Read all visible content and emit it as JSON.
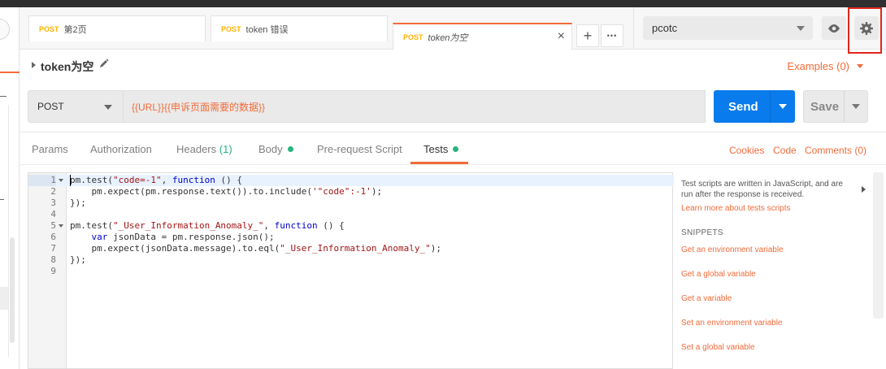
{
  "tabs": [
    {
      "method": "POST",
      "name": "第2页"
    },
    {
      "method": "POST",
      "name": "token 错误"
    },
    {
      "method": "POST",
      "name": "token为空"
    }
  ],
  "tab_actions": {
    "add": "+",
    "more": "•••",
    "close": "×"
  },
  "environment": {
    "selected": "pcotc"
  },
  "request": {
    "name": "token为空",
    "examples_label": "Examples (0)",
    "method": "POST",
    "url": "{{URL}}{{申诉页面需要的数据}}",
    "send_label": "Send",
    "save_label": "Save"
  },
  "request_tabs": [
    {
      "label": "Params"
    },
    {
      "label": "Authorization"
    },
    {
      "label": "Headers",
      "count": "(1)"
    },
    {
      "label": "Body",
      "dot": true
    },
    {
      "label": "Pre-request Script"
    },
    {
      "label": "Tests",
      "dot": true,
      "active": true
    }
  ],
  "aux_links": {
    "cookies": "Cookies",
    "code": "Code",
    "comments": "Comments (0)"
  },
  "code_lines": [
    {
      "n": "1",
      "fold": true,
      "text": "pm.test(\"code=-1\", function () {"
    },
    {
      "n": "2",
      "fold": false,
      "text": "    pm.expect(pm.response.text()).to.include('\"code\":-1');"
    },
    {
      "n": "3",
      "fold": false,
      "text": "});"
    },
    {
      "n": "4",
      "fold": false,
      "text": ""
    },
    {
      "n": "5",
      "fold": true,
      "text": "pm.test(\"_User_Information_Anomaly_\", function () {"
    },
    {
      "n": "6",
      "fold": false,
      "text": "    var jsonData = pm.response.json();"
    },
    {
      "n": "7",
      "fold": false,
      "text": "    pm.expect(jsonData.message).to.eql(\"_User_Information_Anomaly_\");"
    },
    {
      "n": "8",
      "fold": false,
      "text": "});"
    },
    {
      "n": "9",
      "fold": false,
      "text": ""
    }
  ],
  "snippets": {
    "description": "Test scripts are written in JavaScript, and are run after the response is received.",
    "learn_more": "Learn more about tests scripts",
    "heading": "SNIPPETS",
    "items": [
      "Get an environment variable",
      "Get a global variable",
      "Get a variable",
      "Set an environment variable",
      "Set a global variable"
    ]
  },
  "colors": {
    "accent": "#f26b3a",
    "send": "#097bed",
    "method_tab": "#ffb400",
    "status_dot": "#26b47f",
    "highlight_box": "#e0261b"
  },
  "icons": {
    "eye": "eye-icon",
    "gear": "gear-icon",
    "pencil": "pencil-icon"
  }
}
